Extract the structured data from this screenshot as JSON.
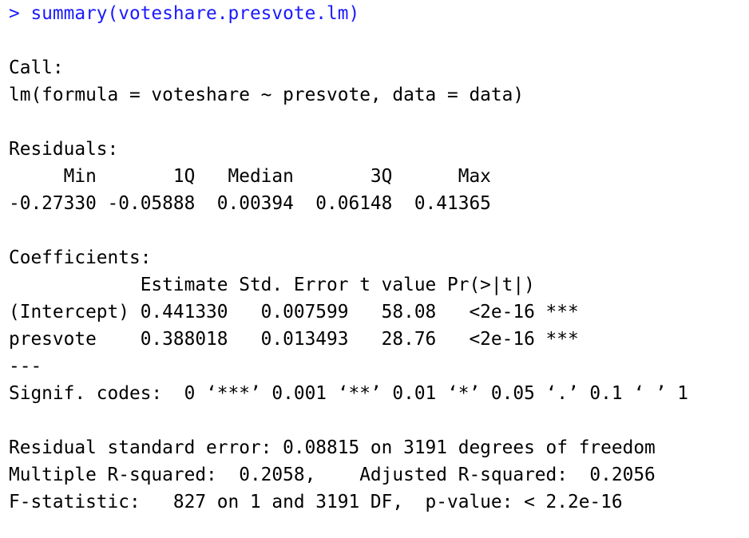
{
  "console": {
    "prompt": "> ",
    "command": "summary(voteshare.presvote.lm)",
    "colors": {
      "input": "#1a1aff",
      "output": "#000000",
      "background": "#ffffff"
    },
    "lines": [
      "",
      "Call:",
      "lm(formula = voteshare ~ presvote, data = data)",
      "",
      "Residuals:",
      "     Min       1Q   Median       3Q      Max ",
      "-0.27330 -0.05888  0.00394  0.06148  0.41365 ",
      "",
      "Coefficients:",
      "            Estimate Std. Error t value Pr(>|t|)    ",
      "(Intercept) 0.441330   0.007599   58.08   <2e-16 ***",
      "presvote    0.388018   0.013493   28.76   <2e-16 ***",
      "---",
      "Signif. codes:  0 ‘***’ 0.001 ‘**’ 0.01 ‘*’ 0.05 ‘.’ 0.1 ‘ ’ 1",
      "",
      "Residual standard error: 0.08815 on 3191 degrees of freedom",
      "Multiple R-squared:  0.2058,    Adjusted R-squared:  0.2056 ",
      "F-statistic:   827 on 1 and 3191 DF,  p-value: < 2.2e-16"
    ]
  }
}
